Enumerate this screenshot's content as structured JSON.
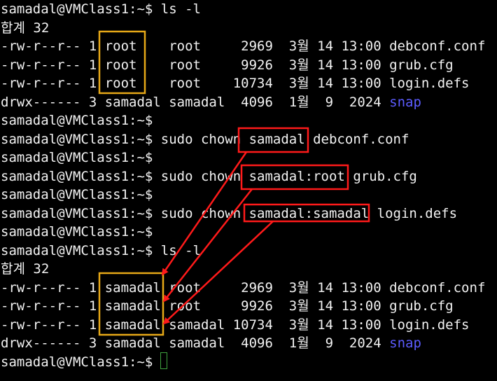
{
  "terminal": {
    "lines": [
      {
        "text": "samadal@VMClass1:~$ ls -l"
      },
      {
        "text": "합계 32"
      },
      {
        "text": "-rw-r--r-- 1 root    root     2969  3월 14 13:00 debconf.conf"
      },
      {
        "text": "-rw-r--r-- 1 root    root     9926  3월 14 13:00 grub.cfg"
      },
      {
        "text": "-rw-r--r-- 1 root    root    10734  3월 14 13:00 login.defs"
      },
      {
        "text": "drwx------ 3 samadal samadal  4096  1월  9  2024 ",
        "dir": "snap"
      },
      {
        "text": "samadal@VMClass1:~$"
      },
      {
        "text": "samadal@VMClass1:~$ sudo chown samadal debconf.conf"
      },
      {
        "text": "samadal@VMClass1:~$"
      },
      {
        "text": "samadal@VMClass1:~$ sudo chown samadal:root grub.cfg"
      },
      {
        "text": "samadal@VMClass1:~$"
      },
      {
        "text": "samadal@VMClass1:~$ sudo chown samadal:samadal login.defs"
      },
      {
        "text": "samadal@VMClass1:~$"
      },
      {
        "text": "samadal@VMClass1:~$ ls -l"
      },
      {
        "text": "합계 32"
      },
      {
        "text": "-rw-r--r-- 1 samadal root     2969  3월 14 13:00 debconf.conf"
      },
      {
        "text": "-rw-r--r-- 1 samadal root     9926  3월 14 13:00 grub.cfg"
      },
      {
        "text": "-rw-r--r-- 1 samadal samadal 10734  3월 14 13:00 login.defs"
      },
      {
        "text": "drwx------ 3 samadal samadal  4096  1월  9  2024 ",
        "dir": "snap"
      },
      {
        "text": "samadal@VMClass1:~$ "
      }
    ]
  },
  "colors": {
    "background": "#000000",
    "text": "#f2f2f2",
    "directory": "#5c5cff",
    "highlight_yellow": "#e6a817",
    "highlight_red": "#ff0000",
    "cursor": "#3fa33f"
  }
}
